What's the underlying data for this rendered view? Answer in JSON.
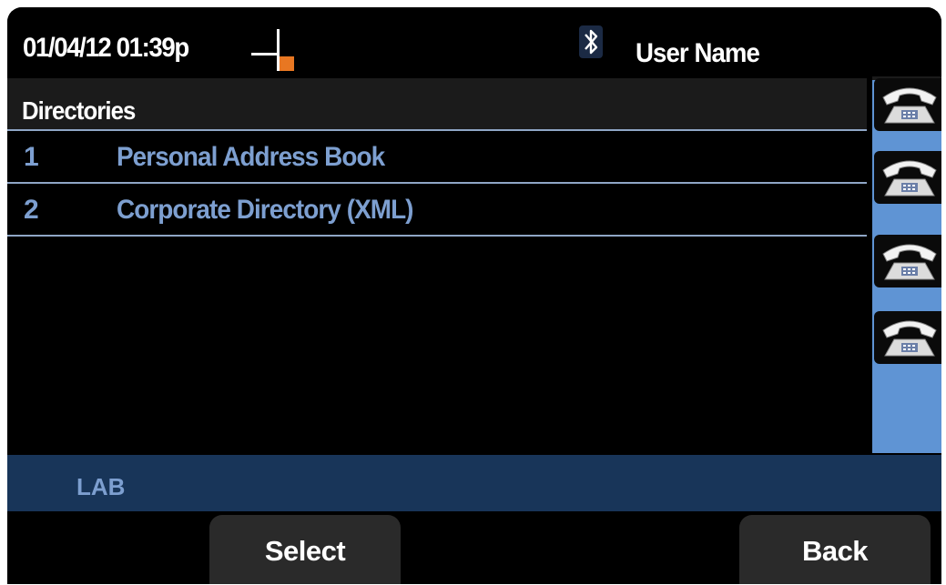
{
  "status_bar": {
    "datetime": "01/04/12 01:39p",
    "line_icon": "line-status-icon",
    "bluetooth_icon": "bluetooth-icon",
    "username": "User Name"
  },
  "header": {
    "title": "Directories"
  },
  "list": {
    "items": [
      {
        "number": "1",
        "label": "Personal Address Book"
      },
      {
        "number": "2",
        "label": "Corporate Directory (XML)"
      }
    ]
  },
  "line_keys": {
    "icon": "phone-handset-icon",
    "count": 4
  },
  "label_bar": {
    "text": "LAB"
  },
  "softkeys": {
    "select": "Select",
    "back": "Back"
  },
  "colors": {
    "background": "#000000",
    "accent_text": "#7d9fd0",
    "side_column": "#5f94d4",
    "label_bar": "#183559",
    "softkey": "#2a2a2a",
    "divider": "#8fa6c6",
    "line_status_orange": "#e87722"
  }
}
